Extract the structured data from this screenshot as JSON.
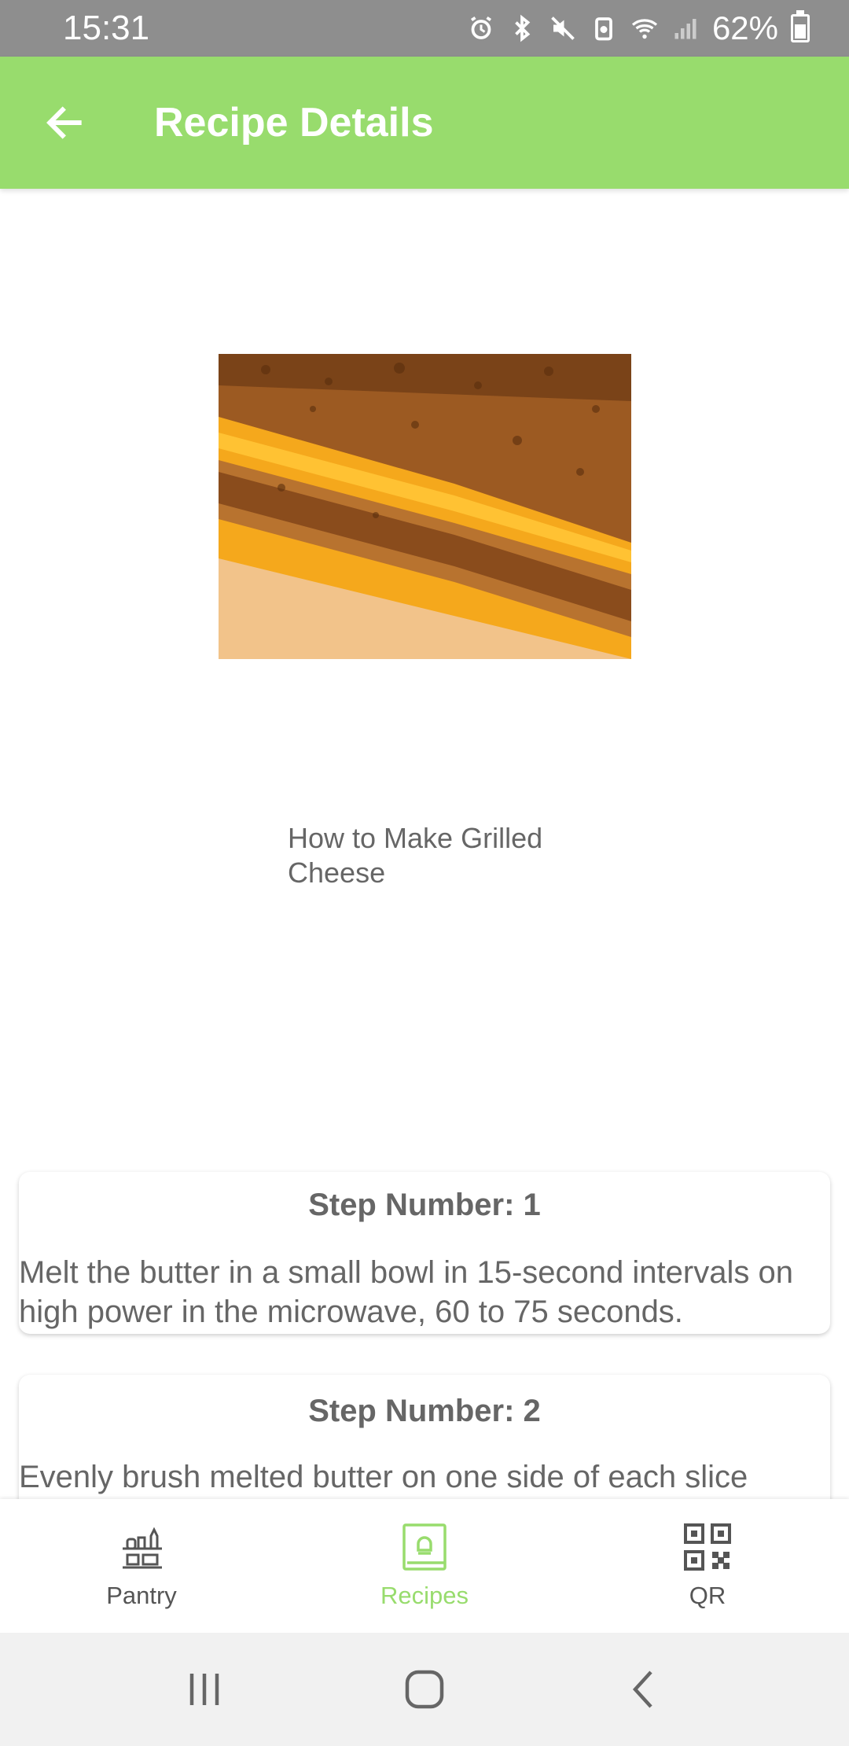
{
  "status_bar": {
    "time": "15:31",
    "battery_percent": "62%",
    "icons": [
      "alarm-icon",
      "bluetooth-icon",
      "mute-icon",
      "battery-saver-icon",
      "wifi-icon",
      "signal-icon",
      "battery-icon"
    ]
  },
  "app_bar": {
    "title": "Recipe Details",
    "back_icon": "arrow-back-icon"
  },
  "recipe": {
    "title": "How to Make Grilled Cheese"
  },
  "steps": [
    {
      "heading": "Step Number: 1",
      "text": "Melt the butter in a small bowl in 15-second intervals on high power in the microwave, 60 to 75 seconds."
    },
    {
      "heading": "Step Number: 2",
      "text": "Evenly brush melted butter on one side of each slice"
    }
  ],
  "bottom_nav": {
    "items": [
      {
        "label": "Pantry",
        "icon": "pantry-icon",
        "active": false
      },
      {
        "label": "Recipes",
        "icon": "recipe-book-icon",
        "active": true
      },
      {
        "label": "QR",
        "icon": "qr-code-icon",
        "active": false
      }
    ]
  },
  "colors": {
    "accent": "#98dc6d",
    "status_bar": "#8e8e8e",
    "text_gray": "#666666"
  }
}
